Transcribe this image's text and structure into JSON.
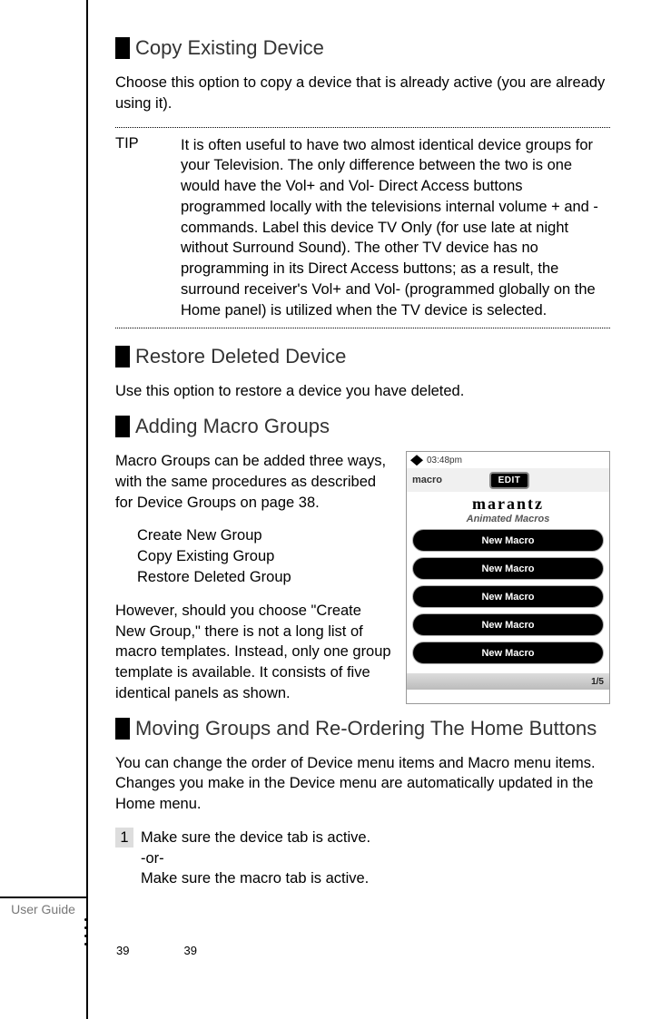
{
  "sections": {
    "copy": {
      "title": "Copy Existing Device",
      "body": "Choose this option to copy a device that is already active (you are already using it)."
    },
    "tip": {
      "label": "TIP",
      "text": "It is often useful to have two almost identical device groups for your Television. The only difference between the two is one would have the Vol+ and Vol- Direct Access buttons programmed locally with the televisions internal volume + and - commands. Label this device TV Only (for use late at night without Surround Sound). The other TV device has no programming in its Direct Access buttons; as a result, the surround receiver's Vol+ and Vol- (programmed globally on the Home panel) is utilized when the TV device is selected."
    },
    "restore": {
      "title": "Restore Deleted Device",
      "body": "Use this option to restore a device you have deleted."
    },
    "adding": {
      "title": "Adding Macro Groups",
      "intro": "Macro Groups can be added three ways, with the same procedures as described for Device Groups on page 38.",
      "options": [
        "Create New Group",
        "Copy Existing Group",
        "Restore Deleted Group"
      ],
      "outro": "However, should you choose \"Create New Group,\" there is not a long list of macro templates. Instead, only one group template is available. It consists of five identical panels as shown."
    },
    "moving": {
      "title": "Moving Groups and  Re-Ordering The Home Buttons",
      "body": "You can change the order of Device menu items and Macro menu items. Changes you make in the Device menu are automatically updated in the Home menu.",
      "step1_a": "Make sure the device tab is active.",
      "step1_or": "-or-",
      "step1_b": "Make sure the macro tab is active.",
      "step1_num": "1"
    }
  },
  "screenshot": {
    "time": "03:48pm",
    "tab": "macro",
    "edit": "EDIT",
    "brand": "marantz",
    "subtitle": "Animated Macros",
    "buttons": [
      "New Macro",
      "New Macro",
      "New Macro",
      "New Macro",
      "New Macro"
    ],
    "page_indicator": "1/5"
  },
  "footer": {
    "label": "User Guide",
    "page_a": "39",
    "page_b": "39"
  }
}
